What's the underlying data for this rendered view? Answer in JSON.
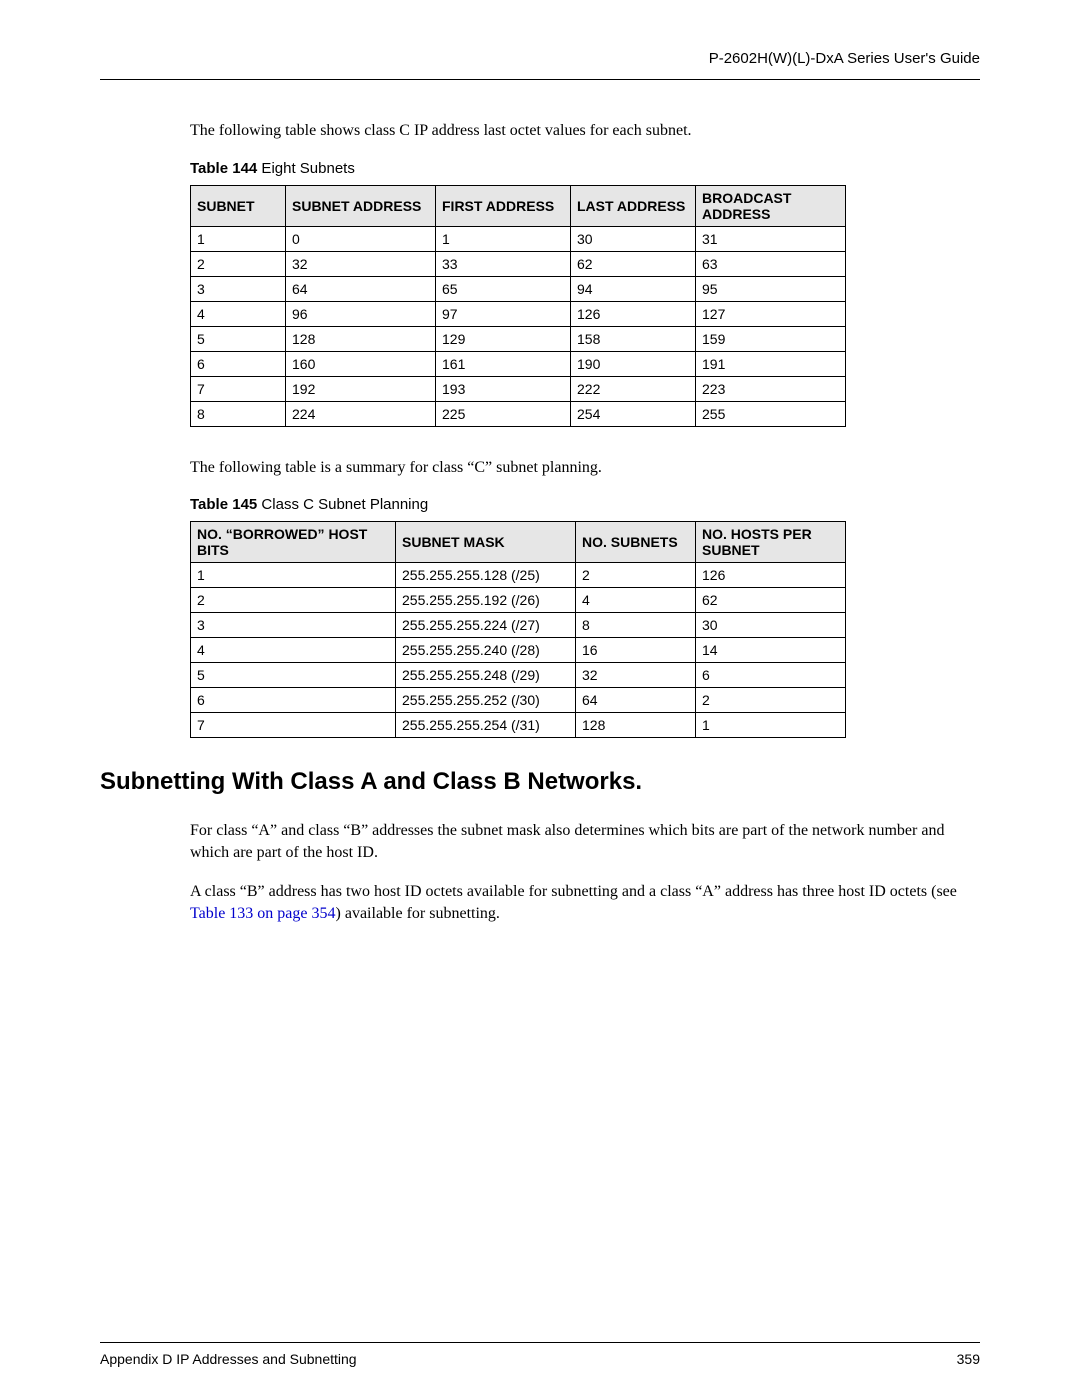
{
  "header": {
    "doc_title": "P-2602H(W)(L)-DxA Series User's Guide"
  },
  "intro1": "The following table shows class C IP address last octet values for each subnet.",
  "table1_caption_bold": "Table 144",
  "table1_caption_rest": "   Eight Subnets",
  "table1": {
    "headers": [
      "SUBNET",
      "SUBNET ADDRESS",
      "FIRST ADDRESS",
      "LAST ADDRESS",
      "BROADCAST ADDRESS"
    ],
    "rows": [
      [
        "1",
        "0",
        "1",
        "30",
        "31"
      ],
      [
        "2",
        "32",
        "33",
        "62",
        "63"
      ],
      [
        "3",
        "64",
        "65",
        "94",
        "95"
      ],
      [
        "4",
        "96",
        "97",
        "126",
        "127"
      ],
      [
        "5",
        "128",
        "129",
        "158",
        "159"
      ],
      [
        "6",
        "160",
        "161",
        "190",
        "191"
      ],
      [
        "7",
        "192",
        "193",
        "222",
        "223"
      ],
      [
        "8",
        "224",
        "225",
        "254",
        "255"
      ]
    ]
  },
  "intro2": "The following table is a summary for class “C” subnet planning.",
  "table2_caption_bold": "Table 145",
  "table2_caption_rest": "   Class C Subnet Planning",
  "table2": {
    "headers": [
      "NO. “BORROWED” HOST BITS",
      "SUBNET MASK",
      "NO. SUBNETS",
      "NO. HOSTS PER SUBNET"
    ],
    "rows": [
      [
        "1",
        "255.255.255.128 (/25)",
        "2",
        "126"
      ],
      [
        "2",
        "255.255.255.192 (/26)",
        "4",
        "62"
      ],
      [
        "3",
        "255.255.255.224 (/27)",
        "8",
        "30"
      ],
      [
        "4",
        "255.255.255.240 (/28)",
        "16",
        "14"
      ],
      [
        "5",
        "255.255.255.248 (/29)",
        "32",
        "6"
      ],
      [
        "6",
        "255.255.255.252 (/30)",
        "64",
        "2"
      ],
      [
        "7",
        "255.255.255.254 (/31)",
        "128",
        "1"
      ]
    ]
  },
  "section_heading": "Subnetting With Class A and Class B Networks.",
  "para1": "For class “A” and class “B” addresses the subnet mask also determines which bits are part of the network number and which are part of the host ID.",
  "para2_pre": "A class “B” address has two host ID octets available for subnetting and a class “A” address has three host ID octets (see ",
  "para2_link": "Table 133 on page 354",
  "para2_post": ") available for subnetting.",
  "footer": {
    "left": "Appendix D IP Addresses and Subnetting",
    "right": "359"
  }
}
